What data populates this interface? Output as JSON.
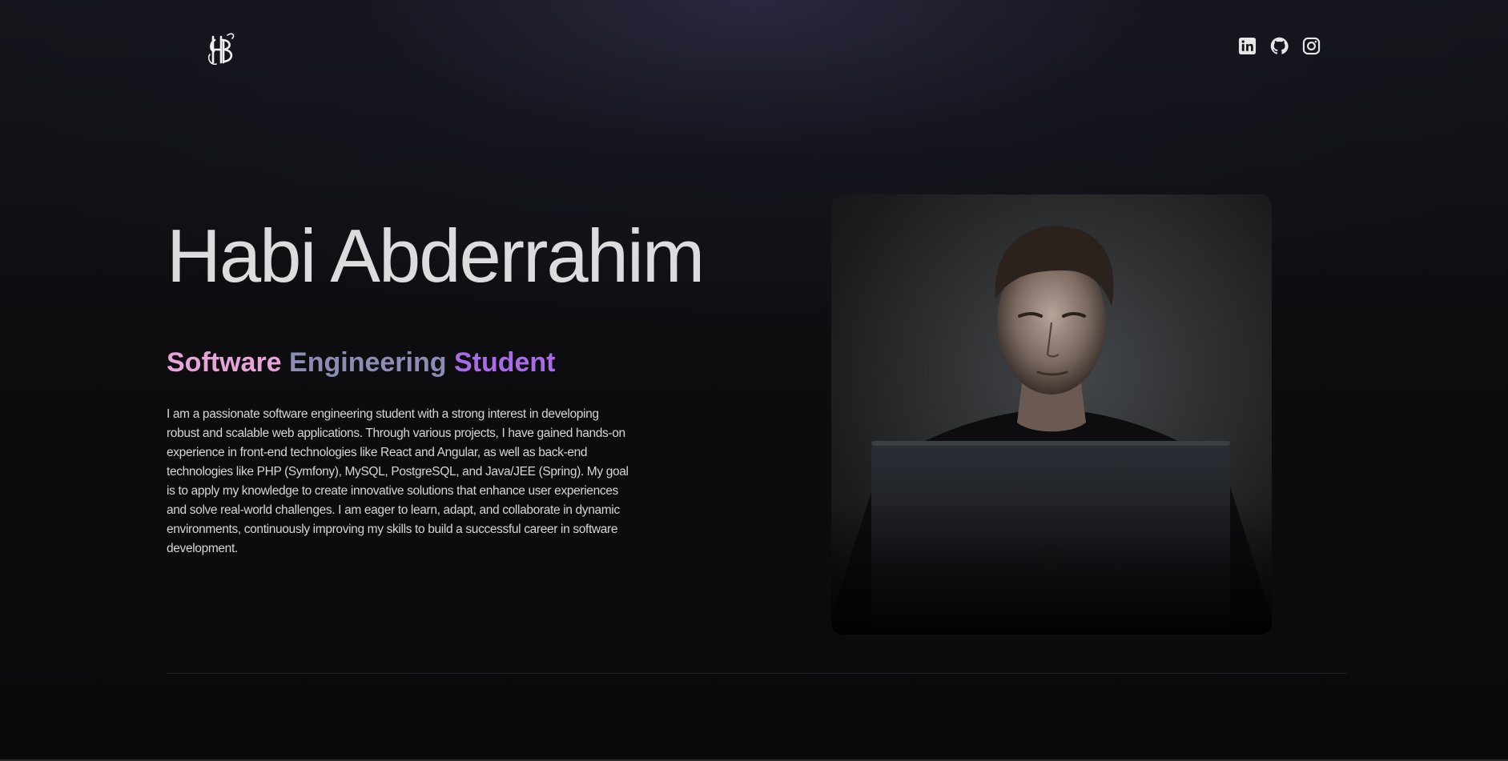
{
  "header": {
    "logo_text": "HB",
    "social_icons": [
      {
        "name": "linkedin-icon"
      },
      {
        "name": "github-icon"
      },
      {
        "name": "instagram-icon"
      }
    ]
  },
  "hero": {
    "name": "Habi Abderrahim",
    "role_words": [
      "Software",
      "Engineering",
      "Student"
    ],
    "bio": "I am a passionate software engineering student with a strong interest in developing robust and scalable web applications. Through various projects, I have gained hands-on experience in front-end technologies like React and Angular, as well as back-end technologies like PHP (Symfony), MySQL, PostgreSQL, and Java/JEE (Spring). My goal is to apply my knowledge to create innovative solutions that enhance user experiences and solve real-world challenges. I am eager to learn, adapt, and collaborate in dynamic environments, continuously improving my skills to build a successful career in software development."
  },
  "colors": {
    "background": "#0b0b0d",
    "name_text": "#dcdcdf",
    "role_software": "#e6a4d8",
    "role_engineering": "#8c8cb4",
    "role_student": "#a86ce8",
    "body_text": "#d6d6da"
  }
}
